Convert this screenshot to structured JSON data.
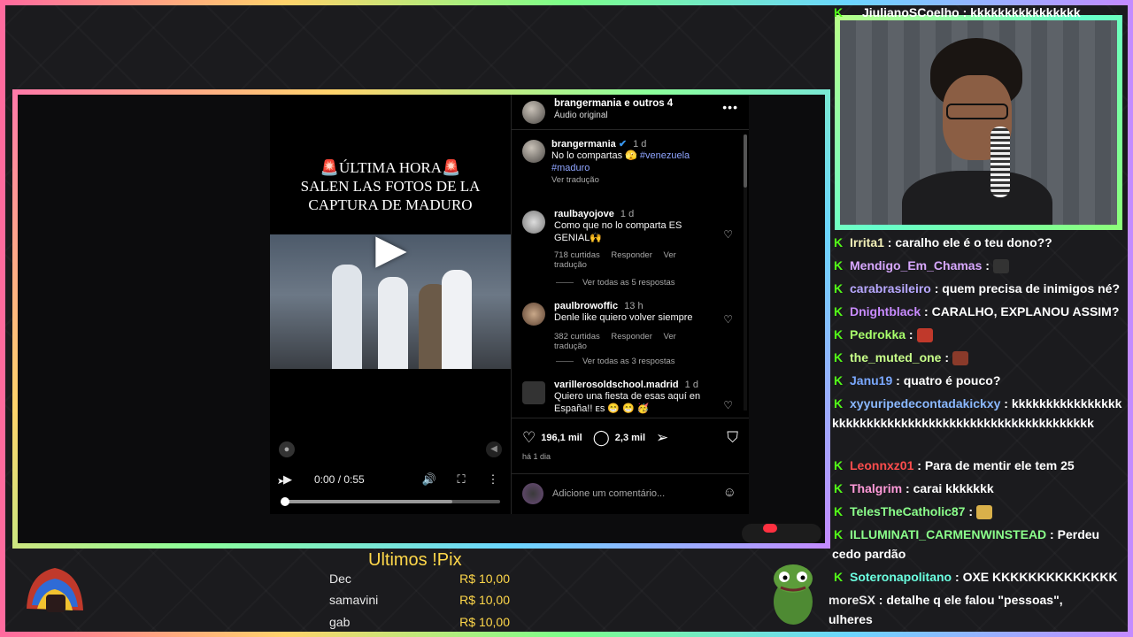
{
  "video": {
    "title_line1": "🚨ÚLTIMA HORA🚨",
    "title_line2": "SALEN LAS FOTOS DE LA",
    "title_line3": "CAPTURA DE MADURO",
    "time": "0:00 / 0:55",
    "progress": 0.0,
    "buffered": 0.78
  },
  "ig": {
    "header_name": "brangermania e outros 4",
    "header_sub": "Áudio original",
    "caption": {
      "user": "brangermania",
      "time": "1 d",
      "text": "No lo compartas 🫣",
      "tags": [
        "#venezuela",
        "#maduro"
      ],
      "see_translation": "Ver tradução"
    },
    "comments": [
      {
        "user": "raulbayojove",
        "time": "1 d",
        "text": "Como que no lo comparta ES GENIAL🙌",
        "likes": "718 curtidas",
        "reply": "Responder",
        "translate": "Ver tradução",
        "replies": "Ver todas as 5 respostas"
      },
      {
        "user": "paulbrowoffic",
        "time": "13 h",
        "text": "Denle like quiero volver siempre",
        "likes": "382 curtidas",
        "reply": "Responder",
        "translate": "Ver tradução",
        "replies": "Ver todas as 3 respostas"
      },
      {
        "user": "varillerosoldschool.madrid",
        "time": "1 d",
        "text": "Quiero una fiesta de esas aquí en España!! ᴇs 😁 😁 🥳"
      }
    ],
    "likes_count": "196,1 mil",
    "comments_count": "2,3 mil",
    "posted": "há 1 dia",
    "add_comment_placeholder": "Adicione um comentário..."
  },
  "chat": [
    {
      "user": "JiulianoSCoelho",
      "color": "#ffffff",
      "text": "kkkkkkkkkkkkkkkk"
    },
    {
      "user": "Irrita1",
      "color": "#f3f0b8",
      "text": "caralho ele é o teu dono??"
    },
    {
      "user": "Mendigo_Em_Chamas",
      "color": "#d8a8ff",
      "text": ""
    },
    {
      "user": "carabrasileiro",
      "color": "#b8a8ff",
      "text": "quem precisa de inimigos né?"
    },
    {
      "user": "Dnightblack",
      "color": "#c88bff",
      "text": "CARALHO, EXPLANOU ASSIM?"
    },
    {
      "user": "Pedrokka",
      "color": "#a8ff6b",
      "text": ""
    },
    {
      "user": "the_muted_one",
      "color": "#c8ff8a",
      "text": ""
    },
    {
      "user": "Janu19",
      "color": "#7aa8ff",
      "text": "quatro é pouco?"
    },
    {
      "user": "xyyuripedecontadakickxy",
      "color": "#8ab8ff",
      "text": "kkkkkkkkkkkkkkkkkkkkkkkkkkkkkkkkkkkkkkkkkkkkkkkkkkkkkk"
    },
    {
      "user": "Leonnxz01",
      "color": "#ff4d4d",
      "text": "Para de mentir ele tem 25"
    },
    {
      "user": "Thalgrim",
      "color": "#ff9ad8",
      "text": "carai kkkkkkk"
    },
    {
      "user": "TelesTheCatholic87",
      "color": "#8bff8b",
      "text": ""
    },
    {
      "user": "ILLUMINATI_CARMENWINSTEAD",
      "color": "#8bff8b",
      "text": "Perdeu cedo pardão"
    },
    {
      "user": "Soteronapolitano",
      "color": "#6bffe0",
      "text": "OXE KKKKKKKKKKKKKK"
    },
    {
      "user": "moreSX",
      "color": "#e8e8e8",
      "text": "detalhe q ele falou \"pessoas\","
    },
    {
      "user": "",
      "color": "#ffffff",
      "text": "ulheres"
    }
  ],
  "pix": {
    "title": "Ultimos !Pix",
    "rows": [
      {
        "name": "Dec",
        "value": "R$ 10,00"
      },
      {
        "name": "samavini",
        "value": "R$ 10,00"
      },
      {
        "name": "gab",
        "value": "R$ 10,00"
      }
    ]
  }
}
